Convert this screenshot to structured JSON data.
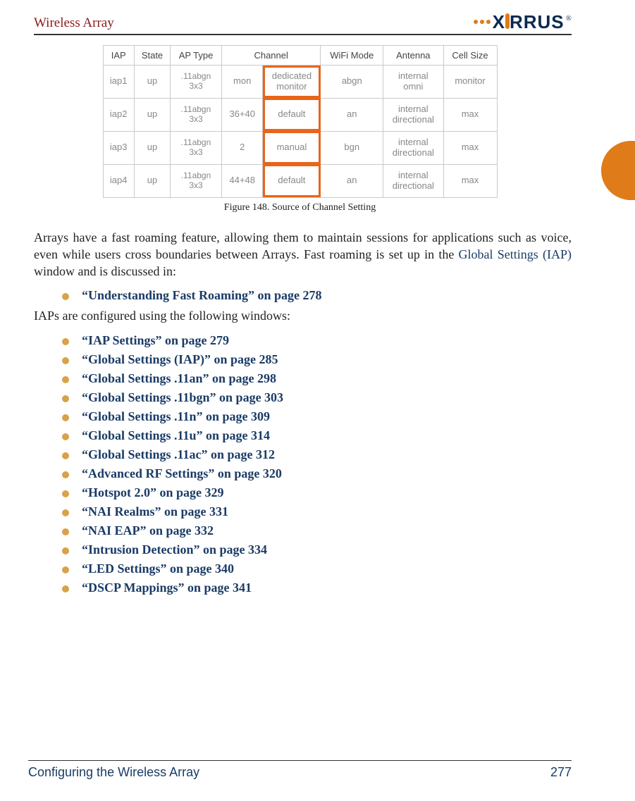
{
  "header": {
    "title": "Wireless Array",
    "logo_text": "X RRUS",
    "logo_trademark": "®"
  },
  "side_tab_color": "#e07b1a",
  "figure": {
    "caption": "Figure 148. Source of Channel Setting",
    "columns": [
      "IAP",
      "State",
      "AP Type",
      "Channel",
      "WiFi Mode",
      "Antenna",
      "Cell Size"
    ],
    "highlight_col_index": 3,
    "rows": [
      {
        "iap": "iap1",
        "state": "up",
        "aptype": ".11abgn\n3x3",
        "channel_left": "mon",
        "channel": "dedicated\nmonitor",
        "wifi": "abgn",
        "ant": "internal\nomni",
        "cell": "monitor"
      },
      {
        "iap": "iap2",
        "state": "up",
        "aptype": ".11abgn\n3x3",
        "channel_left": "36+40",
        "channel": "default",
        "wifi": "an",
        "ant": "internal\ndirectional",
        "cell": "max"
      },
      {
        "iap": "iap3",
        "state": "up",
        "aptype": ".11abgn\n3x3",
        "channel_left": "2",
        "channel": "manual",
        "wifi": "bgn",
        "ant": "internal\ndirectional",
        "cell": "max"
      },
      {
        "iap": "iap4",
        "state": "up",
        "aptype": ".11abgn\n3x3",
        "channel_left": "44+48",
        "channel": "default",
        "wifi": "an",
        "ant": "internal\ndirectional",
        "cell": "max"
      }
    ]
  },
  "body": {
    "para1_a": "Arrays have a fast roaming feature, allowing them to maintain sessions for applications such as voice, even while users cross boundaries between Arrays. Fast roaming is set up in the ",
    "para1_link": "Global Settings (IAP)",
    "para1_b": " window and is discussed in:",
    "list1": [
      "“Understanding Fast Roaming” on page 278"
    ],
    "para2": "IAPs are configured using the following windows:",
    "list2": [
      "“IAP Settings” on page 279",
      "“Global Settings (IAP)” on page 285",
      "“Global Settings .11an” on page 298",
      "“Global Settings .11bgn” on page 303",
      "“Global Settings .11n” on page 309",
      "“Global Settings .11u” on page 314",
      "“Global Settings .11ac” on page 312",
      "“Advanced RF Settings” on page 320",
      "“Hotspot 2.0” on page 329",
      "“NAI Realms” on page 331",
      "“NAI EAP” on page 332",
      "“Intrusion Detection” on page 334",
      "“LED Settings” on page 340",
      "“DSCP Mappings” on page 341"
    ]
  },
  "footer": {
    "section": "Configuring the Wireless Array",
    "page": "277"
  }
}
